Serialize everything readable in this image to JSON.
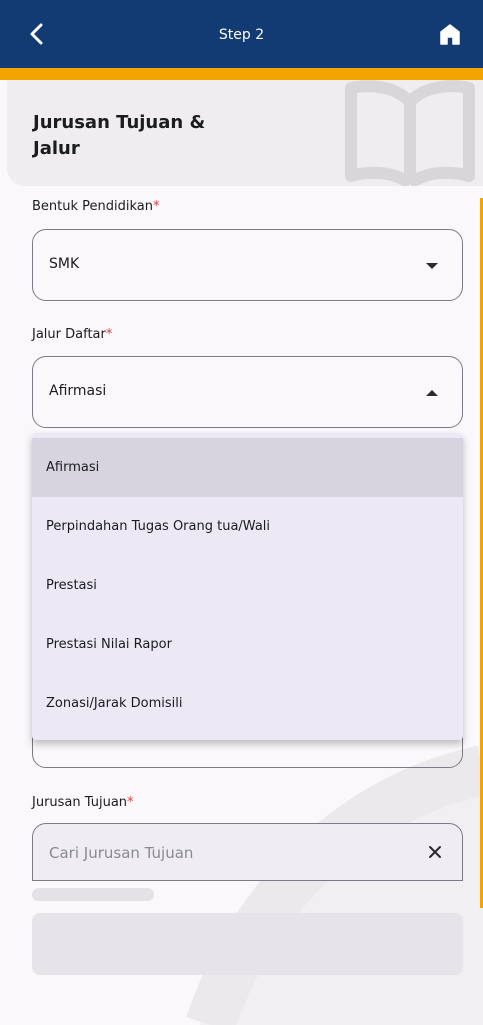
{
  "header": {
    "title": "Step 2"
  },
  "hero": {
    "heading": "Jurusan Tujuan & Jalur"
  },
  "bentuk": {
    "label": "Bentuk Pendidikan",
    "required": "*",
    "value": "SMK"
  },
  "jalur": {
    "label": "Jalur Daftar",
    "required": "*",
    "value": "Afirmasi",
    "options": [
      "Afirmasi",
      "Perpindahan Tugas Orang tua/Wali",
      "Prestasi",
      "Prestasi Nilai Rapor",
      "Zonasi/Jarak Domisili"
    ],
    "selected": "Afirmasi"
  },
  "jurusan": {
    "label": "Jurusan Tujuan",
    "required": "*",
    "placeholder": "Cari Jurusan Tujuan"
  },
  "colors": {
    "primary": "#123a73",
    "accent": "#f2a500",
    "required": "#e23a3a"
  },
  "icons": {
    "back": "chevron-left-icon",
    "home": "home-icon",
    "clear": "close-icon"
  }
}
